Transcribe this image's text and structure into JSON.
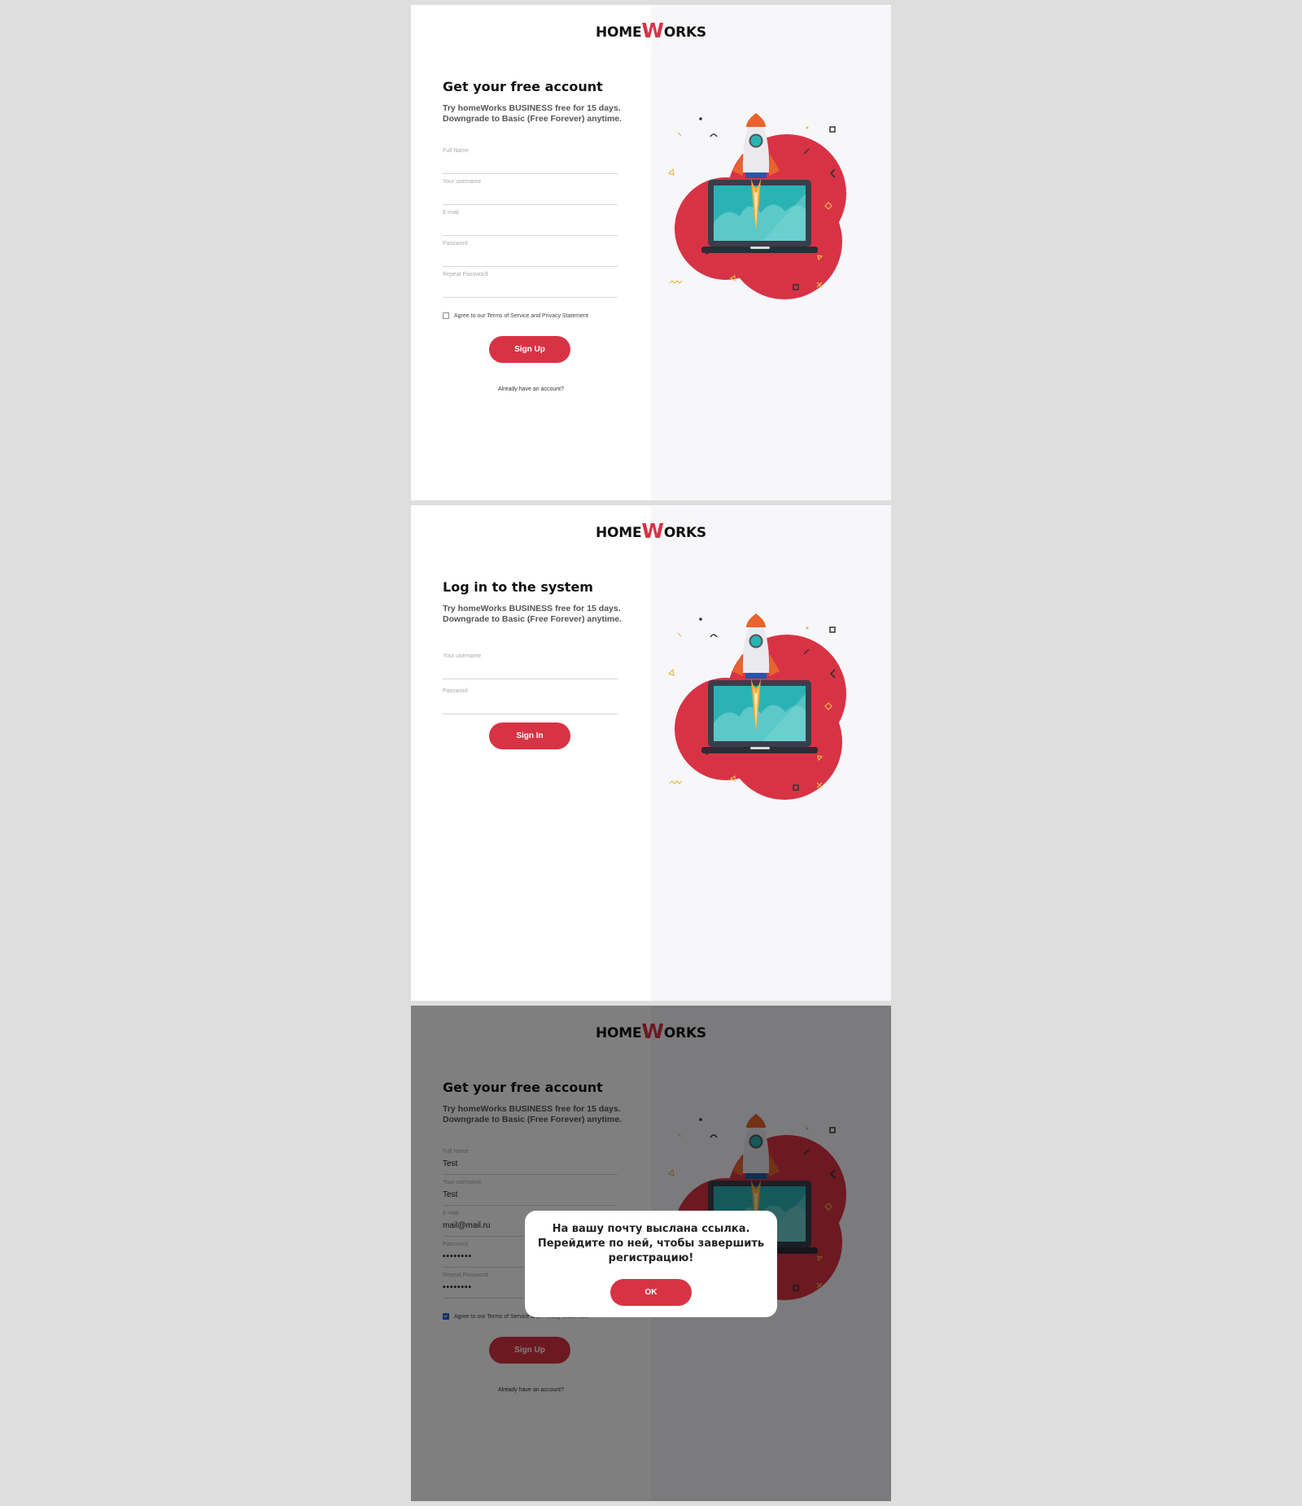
{
  "logo": {
    "prefix": "HOME",
    "w": "W",
    "suffix": "ORKS"
  },
  "signup": {
    "title": "Get your free account",
    "subtitle_line1": "Try homeWorks BUSINESS free for 15 days.",
    "subtitle_line2": "Downgrade to Basic (Free Forever) anytime.",
    "fields": {
      "full_name": "Full Name",
      "username": "Your username",
      "email": "E-mail",
      "password": "Password",
      "repeat_password": "Repeat Password"
    },
    "agree_label": "Agree to our Terms of Service and Privacy Statement",
    "submit_label": "Sign Up",
    "already_link": "Already have an account?"
  },
  "login": {
    "title": "Log in to the system",
    "subtitle_line1": "Try homeWorks BUSINESS free for 15 days.",
    "subtitle_line2": "Downgrade to Basic (Free Forever) anytime.",
    "fields": {
      "username": "Your username",
      "password": "Password"
    },
    "submit_label": "Sign In"
  },
  "filled": {
    "values": {
      "full_name": "Test",
      "username": "Test",
      "email": "mail@mail.ru",
      "password": "••••••••",
      "repeat_password": "••••••••"
    },
    "agree_checked": true
  },
  "modal": {
    "line1": "На вашу почту выслана ссылка.",
    "line2": "Перейдите по ней, чтобы завершить",
    "line3": "регистрацию!",
    "ok_label": "OK"
  },
  "colors": {
    "accent": "#d83345",
    "page_bg": "#dedede",
    "right_panel": "#f7f7fa",
    "teal": "#2ab3b5",
    "rocket_orange": "#e8642c"
  }
}
